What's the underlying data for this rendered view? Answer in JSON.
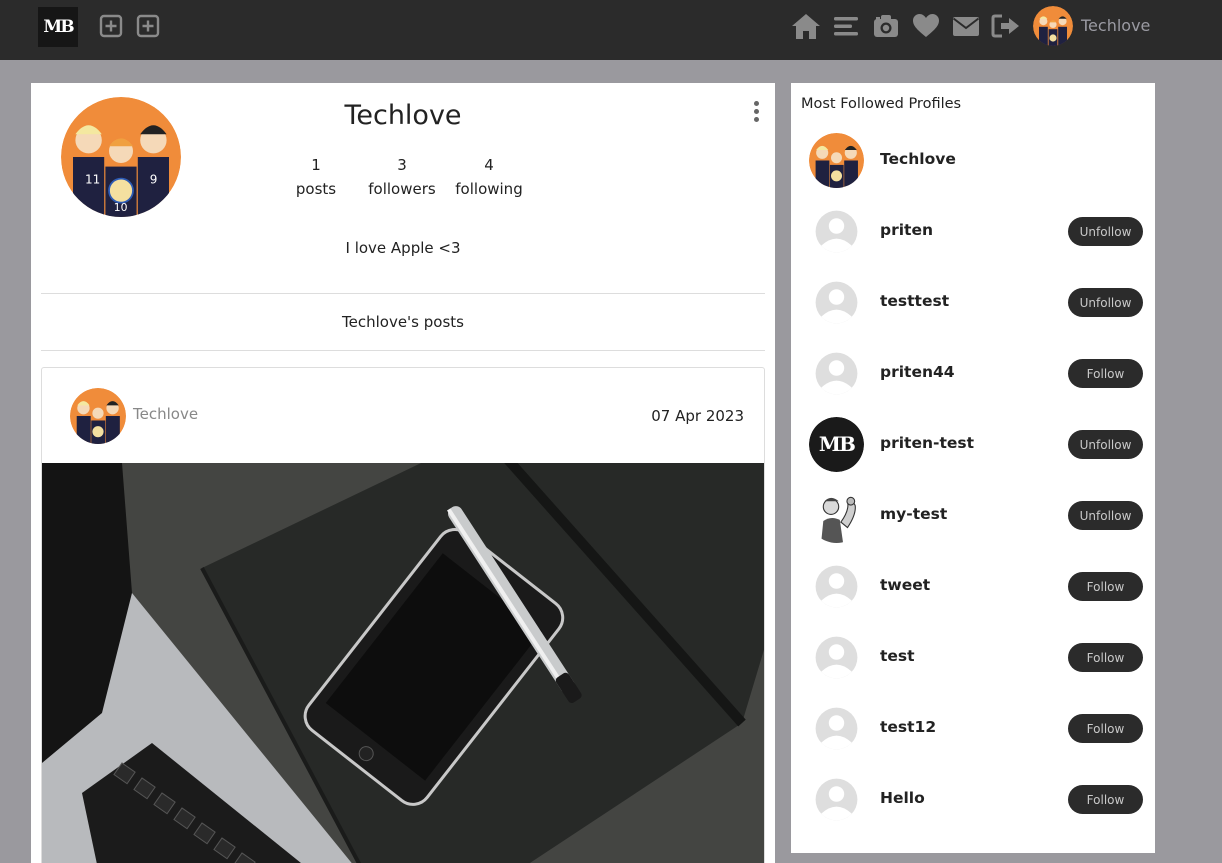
{
  "navbar": {
    "logo_text": "MB",
    "username": "Techlove",
    "icons": [
      "add-post-icon",
      "add-story-icon",
      "home-icon",
      "menu-icon",
      "camera-icon",
      "heart-icon",
      "envelope-icon",
      "logout-icon"
    ]
  },
  "profile": {
    "name": "Techlove",
    "posts_count": "1",
    "posts_label": "posts",
    "followers_count": "3",
    "followers_label": "followers",
    "following_count": "4",
    "following_label": "following",
    "bio": "I love Apple <3",
    "posts_title": "Techlove's posts"
  },
  "post": {
    "username": "Techlove",
    "date": "07 Apr 2023"
  },
  "sidebar": {
    "title": "Most Followed Profiles",
    "profiles": [
      {
        "name": "Techlove",
        "avatar": "anime",
        "action": ""
      },
      {
        "name": "priten",
        "avatar": "default",
        "action": "Unfollow"
      },
      {
        "name": "testtest",
        "avatar": "default",
        "action": "Unfollow"
      },
      {
        "name": "priten44",
        "avatar": "default",
        "action": "Follow"
      },
      {
        "name": "priten-test",
        "avatar": "mb",
        "action": "Unfollow"
      },
      {
        "name": "my-test",
        "avatar": "riveter",
        "action": "Unfollow"
      },
      {
        "name": "tweet",
        "avatar": "default",
        "action": "Follow"
      },
      {
        "name": "test",
        "avatar": "default",
        "action": "Follow"
      },
      {
        "name": "test12",
        "avatar": "default",
        "action": "Follow"
      },
      {
        "name": "Hello",
        "avatar": "default",
        "action": "Follow"
      }
    ]
  },
  "colors": {
    "navbar": "#2b2b2b",
    "page_background": "#9a999e",
    "button": "#2b2b2b",
    "button_text": "#c9c9c9"
  }
}
